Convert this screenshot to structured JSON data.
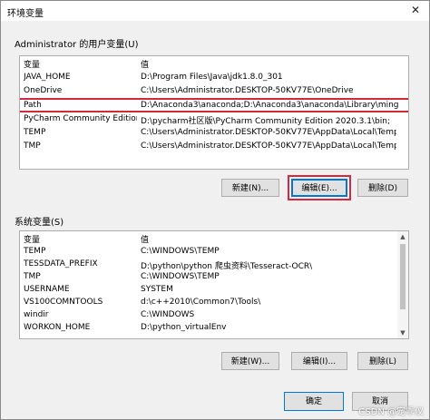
{
  "window": {
    "title": "环境变量",
    "close_glyph": "✕"
  },
  "user_vars": {
    "group_label": "Administrator 的用户变量(U)",
    "columns": {
      "name": "变量",
      "value": "值"
    },
    "rows": [
      {
        "name": "JAVA_HOME",
        "value": "D:\\Program Files\\Java\\jdk1.8.0_301"
      },
      {
        "name": "OneDrive",
        "value": "C:\\Users\\Administrator.DESKTOP-50KV77E\\OneDrive"
      },
      {
        "name": "Path",
        "value": "D:\\Anaconda3\\anaconda;D:\\Anaconda3\\anaconda\\Library\\ming..."
      },
      {
        "name": "PyCharm Community Edition",
        "value": "D:\\pycharm社区版\\PyCharm Community Edition 2020.3.1\\bin;"
      },
      {
        "name": "TEMP",
        "value": "C:\\Users\\Administrator.DESKTOP-50KV77E\\AppData\\Local\\Temp"
      },
      {
        "name": "TMP",
        "value": "C:\\Users\\Administrator.DESKTOP-50KV77E\\AppData\\Local\\Temp"
      }
    ],
    "selected_row": "Path",
    "buttons": {
      "new": "新建(N)...",
      "edit": "编辑(E)...",
      "delete": "删除(D)"
    }
  },
  "system_vars": {
    "group_label": "系统变量(S)",
    "columns": {
      "name": "变量",
      "value": "值"
    },
    "rows": [
      {
        "name": "TEMP",
        "value": "C:\\WINDOWS\\TEMP"
      },
      {
        "name": "TESSDATA_PREFIX",
        "value": "D:\\python\\python 爬虫资料\\Tesseract-OCR\\"
      },
      {
        "name": "TMP",
        "value": "C:\\WINDOWS\\TEMP"
      },
      {
        "name": "USERNAME",
        "value": "SYSTEM"
      },
      {
        "name": "VS100COMNTOOLS",
        "value": "d:\\c++2010\\Common7\\Tools\\"
      },
      {
        "name": "windir",
        "value": "C:\\WINDOWS"
      },
      {
        "name": "WORKON_HOME",
        "value": "D:\\python_virtualEnv"
      }
    ],
    "buttons": {
      "new": "新建(W)...",
      "edit": "编辑(I)...",
      "delete": "删除(L)"
    }
  },
  "footer": {
    "ok": "确定",
    "cancel": "取消"
  },
  "watermark": "CSDN @宠乖仪",
  "colors": {
    "highlight_box": "#d7283b",
    "default_button_border": "#0078d7"
  }
}
